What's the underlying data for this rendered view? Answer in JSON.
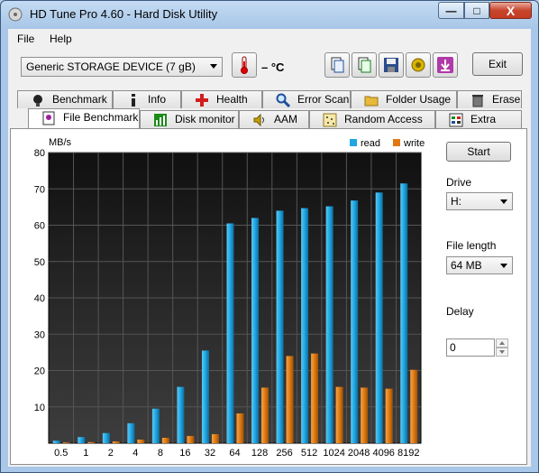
{
  "window": {
    "title": "HD Tune Pro 4.60 - Hard Disk Utility",
    "controls": {
      "minimize": "—",
      "maximize": "□",
      "close": "X"
    }
  },
  "menu": {
    "file": "File",
    "help": "Help"
  },
  "toolbar": {
    "drive": "Generic STORAGE DEVICE  (7 gB)",
    "temperature": "– °C",
    "exit_label": "Exit",
    "icons": [
      "thermometer-icon",
      "copy-icon",
      "copy-all-icon",
      "save-icon",
      "screenshot-icon",
      "download-icon"
    ]
  },
  "tabs_row1": [
    {
      "label": "Benchmark",
      "icon": "benchmark-icon"
    },
    {
      "label": "Info",
      "icon": "info-icon"
    },
    {
      "label": "Health",
      "icon": "health-icon"
    },
    {
      "label": "Error Scan",
      "icon": "error-scan-icon"
    },
    {
      "label": "Folder Usage",
      "icon": "folder-icon"
    },
    {
      "label": "Erase",
      "icon": "erase-icon"
    }
  ],
  "tabs_row2": [
    {
      "label": "File Benchmark",
      "icon": "file-benchmark-icon",
      "active": true
    },
    {
      "label": "Disk monitor",
      "icon": "disk-monitor-icon"
    },
    {
      "label": "AAM",
      "icon": "speaker-icon"
    },
    {
      "label": "Random Access",
      "icon": "random-access-icon"
    },
    {
      "label": "Extra tests",
      "icon": "extra-tests-icon"
    }
  ],
  "side": {
    "start_label": "Start",
    "drive_label": "Drive",
    "drive_value": "H:",
    "file_length_label": "File length",
    "file_length_value": "64 MB",
    "delay_label": "Delay",
    "delay_value": "0"
  },
  "colors": {
    "read": "#1ea7e3",
    "write": "#e07a10",
    "plot_bg": "#141414",
    "grid": "#555555"
  },
  "chart_data": {
    "type": "bar",
    "ylabel": "MB/s",
    "ylim": [
      0,
      80
    ],
    "yticks": [
      10,
      20,
      30,
      40,
      50,
      60,
      70,
      80
    ],
    "categories": [
      "0.5",
      "1",
      "2",
      "4",
      "8",
      "16",
      "32",
      "64",
      "128",
      "256",
      "512",
      "1024",
      "2048",
      "4096",
      "8192"
    ],
    "series": [
      {
        "name": "read",
        "values": [
          0.7,
          1.7,
          2.8,
          5.5,
          9.5,
          15.5,
          25.5,
          60.5,
          62,
          64,
          64.7,
          65.2,
          66.8,
          69,
          71.5
        ]
      },
      {
        "name": "write",
        "values": [
          0.2,
          0.3,
          0.5,
          1.0,
          1.5,
          2.0,
          2.5,
          8.2,
          15.3,
          24,
          24.7,
          15.5,
          15.3,
          15,
          20.2
        ]
      }
    ],
    "legend": "top-right",
    "grid": true
  }
}
